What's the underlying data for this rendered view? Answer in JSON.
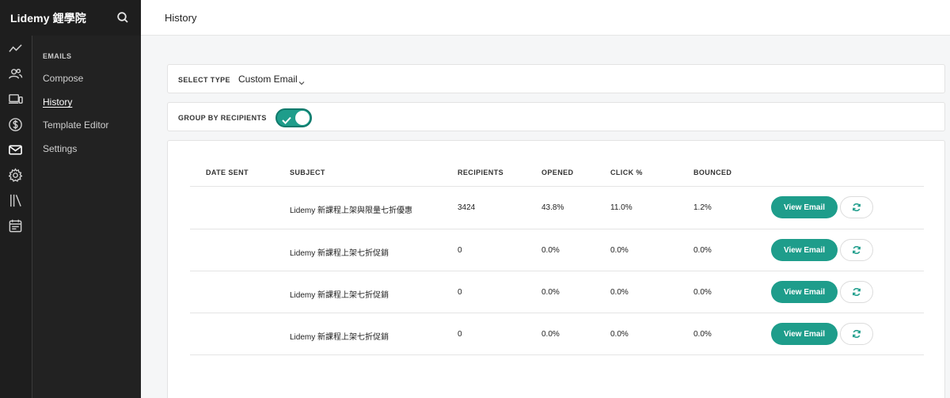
{
  "app": {
    "brand": "Lidemy 鋰學院"
  },
  "header": {
    "title": "History"
  },
  "sidebar": {
    "section": "EMAILS",
    "items": [
      {
        "label": "Compose",
        "active": false
      },
      {
        "label": "History",
        "active": true
      },
      {
        "label": "Template Editor",
        "active": false
      },
      {
        "label": "Settings",
        "active": false
      }
    ]
  },
  "icon_rail": [
    "trend-icon",
    "users-icon",
    "devices-icon",
    "dollar-icon",
    "mail-icon",
    "gear-icon",
    "library-icon",
    "calendar-icon"
  ],
  "filters": {
    "select_type_label": "SELECT TYPE",
    "select_type_value": "Custom Email",
    "group_label": "GROUP BY RECIPIENTS",
    "group_enabled": true
  },
  "table": {
    "columns": [
      "DATE SENT",
      "SUBJECT",
      "RECIPIENTS",
      "OPENED",
      "CLICK %",
      "BOUNCED"
    ],
    "action_label": "View Email",
    "rows": [
      {
        "date_sent": "",
        "subject": "Lidemy 新課程上架與限量七折優惠",
        "recipients": "3424",
        "opened": "43.8%",
        "click": "11.0%",
        "bounced": "1.2%"
      },
      {
        "date_sent": "",
        "subject": "Lidemy 新課程上架七折促銷",
        "recipients": "0",
        "opened": "0.0%",
        "click": "0.0%",
        "bounced": "0.0%"
      },
      {
        "date_sent": "",
        "subject": "Lidemy 新課程上架七折促銷",
        "recipients": "0",
        "opened": "0.0%",
        "click": "0.0%",
        "bounced": "0.0%"
      },
      {
        "date_sent": "",
        "subject": "Lidemy 新課程上架七折促銷",
        "recipients": "0",
        "opened": "0.0%",
        "click": "0.0%",
        "bounced": "0.0%"
      }
    ]
  },
  "colors": {
    "accent": "#1e9d8b",
    "sidebar_bg": "#1e1e1e"
  }
}
